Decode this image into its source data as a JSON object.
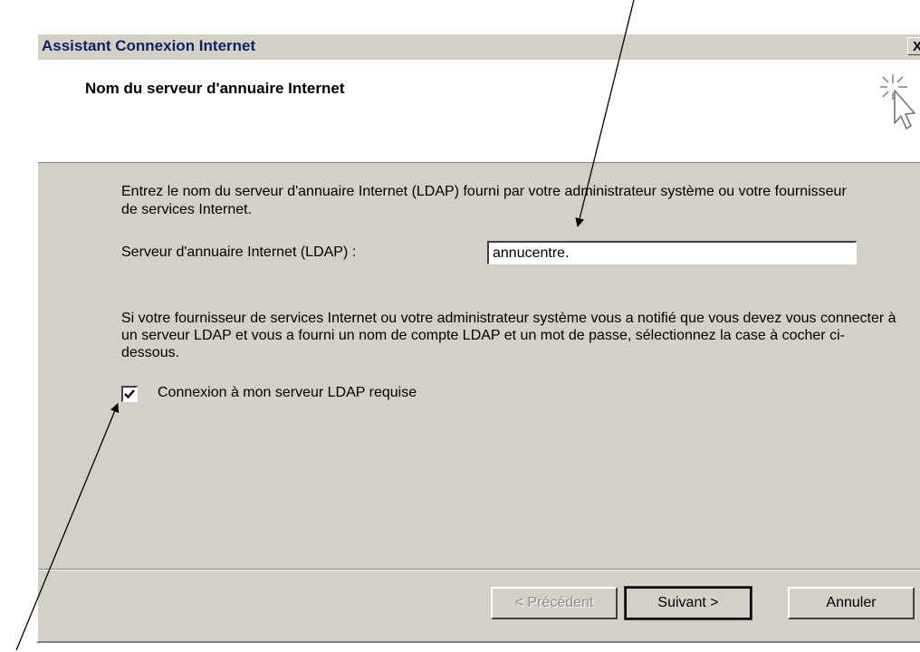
{
  "window": {
    "title": "Assistant Connexion Internet",
    "close_label": "X"
  },
  "header": {
    "title": "Nom du serveur d'annuaire Internet",
    "icon": "wizard-cursor-icon"
  },
  "body": {
    "intro": "Entrez le nom du serveur d'annuaire Internet (LDAP) fourni par votre administrateur système ou votre fournisseur de services Internet.",
    "server_label": "Serveur d'annuaire Internet (LDAP) :",
    "server_value": "annucentre.",
    "notice": "Si votre fournisseur de services Internet ou votre administrateur système vous a notifié que vous devez vous connecter à un serveur LDAP et vous a fourni un nom de compte LDAP et un mot de passe, sélectionnez la case à cocher ci-dessous.",
    "logon_checkbox_label": "Connexion à mon serveur LDAP requise",
    "logon_checked": true
  },
  "buttons": {
    "back_label": "< Précédent",
    "next_label": "Suivant >",
    "cancel_label": "Annuler"
  },
  "colors": {
    "dialog_face": "#d4d0c8",
    "title_text": "#0a246a"
  }
}
